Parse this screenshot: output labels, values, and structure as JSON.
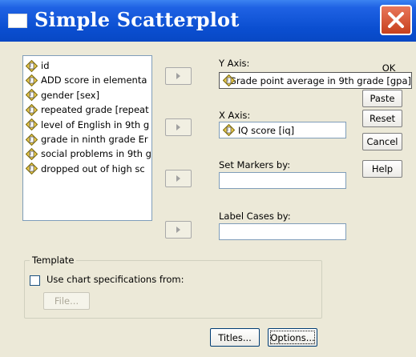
{
  "window": {
    "title": "Simple Scatterplot",
    "close_glyph": "×"
  },
  "variables": [
    {
      "label": "id"
    },
    {
      "label": "ADD score in elementa"
    },
    {
      "label": "gender [sex]"
    },
    {
      "label": "repeated grade [repeat"
    },
    {
      "label": "level of English in 9th g"
    },
    {
      "label": "grade in ninth grade Er"
    },
    {
      "label": "social problems in 9th g"
    },
    {
      "label": "dropped out of high sc"
    }
  ],
  "fields": {
    "y_axis": {
      "label": "Y Axis:",
      "value": "Grade point average in 9th grade [gpa]"
    },
    "x_axis": {
      "label": "X Axis:",
      "value": "IQ score [iq]"
    },
    "set_markers": {
      "label": "Set Markers by:",
      "value": ""
    },
    "label_cases": {
      "label": "Label Cases by:",
      "value": ""
    }
  },
  "buttons": {
    "ok": "OK",
    "paste": "Paste",
    "reset": "Reset",
    "cancel": "Cancel",
    "help": "Help",
    "titles": "Titles...",
    "options": "Options..."
  },
  "template": {
    "group_title": "Template",
    "checkbox_label": "Use chart specifications from:",
    "checkbox_checked": false,
    "file_button": "File..."
  },
  "colors": {
    "titlebar": "#0A4ED0",
    "close_button": "#D9532D",
    "dialog_bg": "#ECE9D8",
    "ruler_icon": "#E8C84A"
  }
}
